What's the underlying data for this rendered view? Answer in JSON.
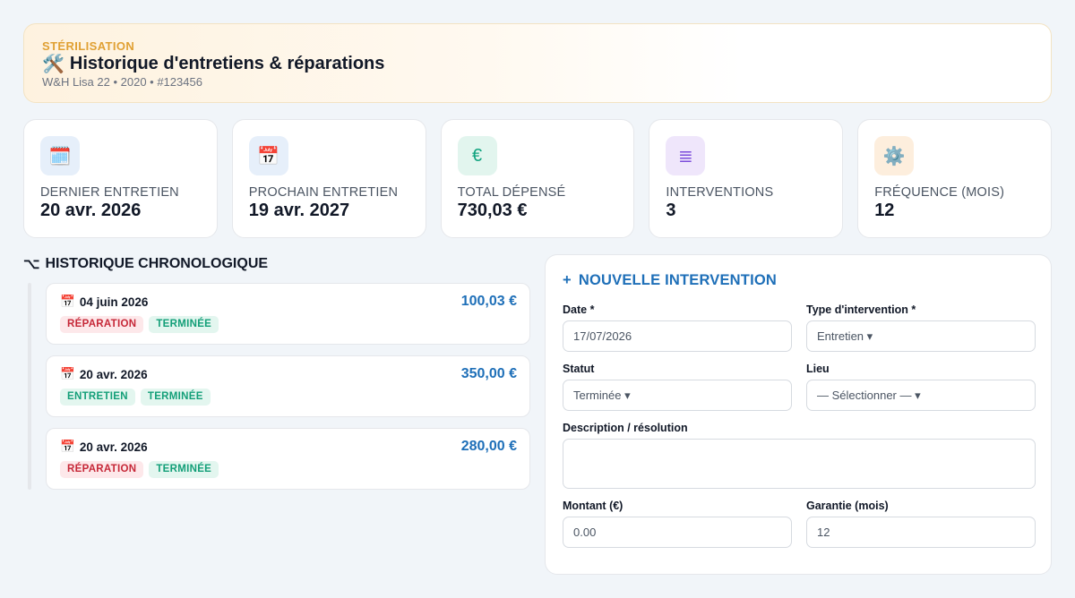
{
  "header": {
    "eyebrow": "STÉRILISATION",
    "icon": "🛠️",
    "title": "Historique d'entretiens & réparations",
    "subtitle": "W&H Lisa 22 • 2020 • #123456"
  },
  "kpis": [
    {
      "icon": "🗓️",
      "icon_name": "calendar-icon",
      "bg": "#e6effa",
      "color": "#3b82f6",
      "label": "DERNIER ENTRETIEN",
      "value": "20 avr. 2026"
    },
    {
      "icon": "📅",
      "icon_name": "calendar-date-icon",
      "bg": "#e6effa",
      "color": "#3b82f6",
      "label": "PROCHAIN ENTRETIEN",
      "value": "19 avr. 2027"
    },
    {
      "icon": "€",
      "icon_name": "euro-icon",
      "bg": "#e2f5ee",
      "color": "#10a37f",
      "label": "TOTAL DÉPENSÉ",
      "value": "730,03 €"
    },
    {
      "icon": "≣",
      "icon_name": "list-icon",
      "bg": "#efe6fb",
      "color": "#7c4ddb",
      "label": "INTERVENTIONS",
      "value": "3"
    },
    {
      "icon": "⚙️",
      "icon_name": "gear-icon",
      "bg": "#fdeedd",
      "color": "#e08a2b",
      "label": "FRÉQUENCE (MOIS)",
      "value": "12"
    }
  ],
  "timeline": {
    "icon": "⌥",
    "heading": "HISTORIQUE CHRONOLOGIQUE",
    "entries": [
      {
        "icon": "📅",
        "date": "04 juin 2026",
        "amount": "100,03 €",
        "type": "RÉPARATION",
        "status": "TERMINÉE"
      },
      {
        "icon": "📅",
        "date": "20 avr. 2026",
        "amount": "350,00 €",
        "type": "ENTRETIEN",
        "status": "TERMINÉE"
      },
      {
        "icon": "📅",
        "date": "20 avr. 2026",
        "amount": "280,00 €",
        "type": "RÉPARATION",
        "status": "TERMINÉE"
      }
    ]
  },
  "form": {
    "icon": "+",
    "title": "NOUVELLE INTERVENTION",
    "date_label": "Date *",
    "date_value": "17/07/2026",
    "type_label": "Type d'intervention *",
    "type_value": "Entretien ▾",
    "status_label": "Statut",
    "status_value": "Terminée ▾",
    "location_label": "Lieu",
    "location_value": "— Sélectionner — ▾",
    "description_label": "Description / résolution",
    "description_value": "",
    "amount_label": "Montant (€)",
    "amount_value": "0.00",
    "warranty_label": "Garantie (mois)",
    "warranty_value": "12"
  }
}
